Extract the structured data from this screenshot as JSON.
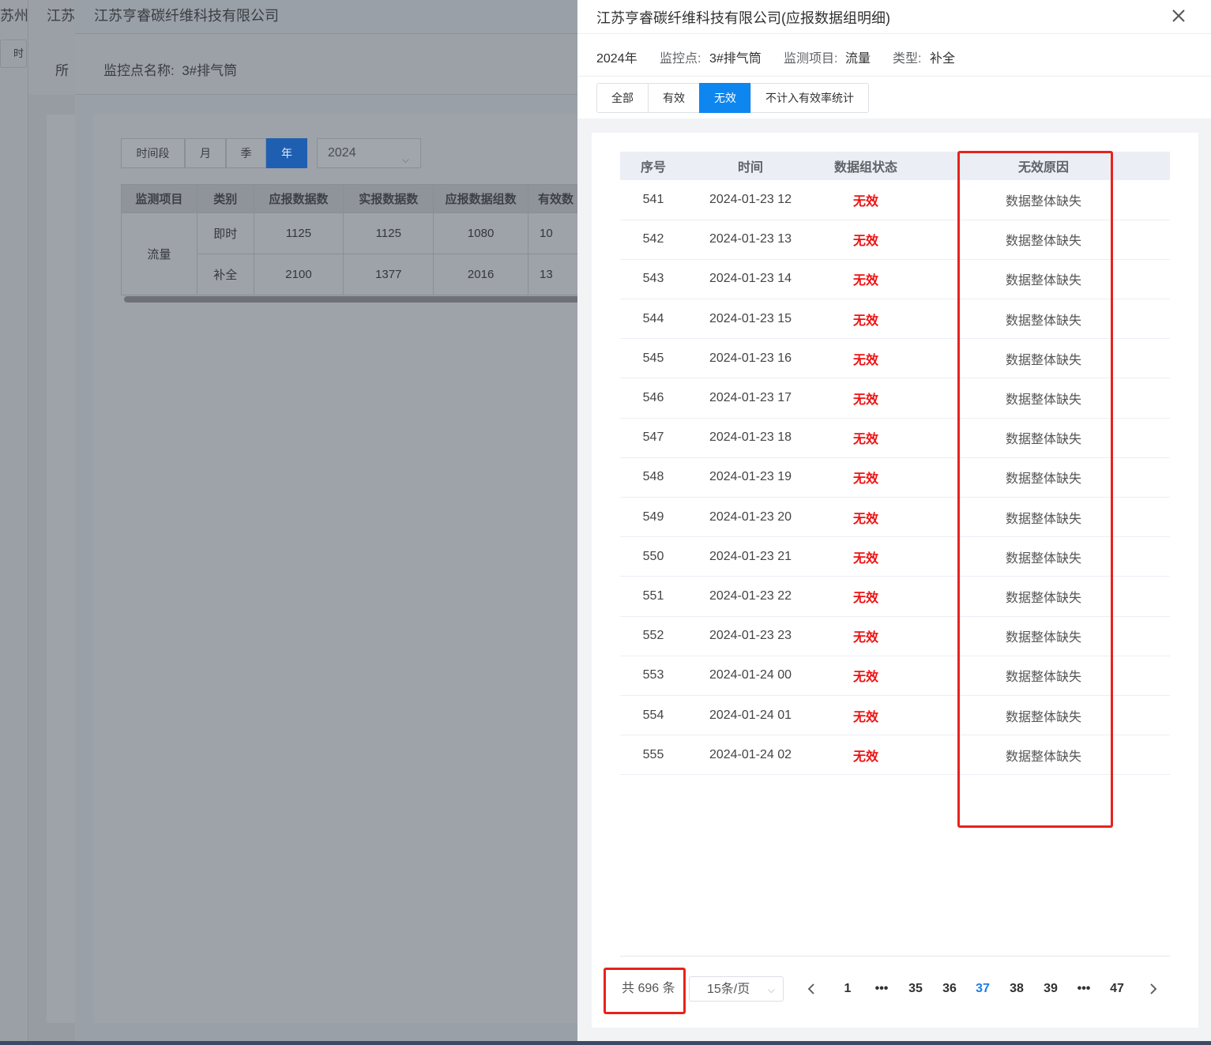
{
  "background": {
    "crumbs": [
      "苏州",
      "江苏"
    ],
    "strip_button": "时",
    "strip_label": "所",
    "panel_title": "江苏亨睿碳纤维科技有限公司",
    "point_name_label": "监控点名称:",
    "point_name_value": "3#排气筒",
    "period_tabs": [
      "时间段",
      "月",
      "季",
      "年"
    ],
    "active_period": "年",
    "year_select": "2024",
    "table": {
      "headers": [
        "监测项目",
        "类别",
        "应报数据数",
        "实报数据数",
        "应报数据组数",
        "有效数"
      ],
      "item": "流量",
      "rows": [
        {
          "category": "即时",
          "c1": "1125",
          "c2": "1125",
          "c3": "1080",
          "c4": "10"
        },
        {
          "category": "补全",
          "c1": "2100",
          "c2": "1377",
          "c3": "2016",
          "c4": "13"
        }
      ]
    }
  },
  "drawer": {
    "title": "江苏亨睿碳纤维科技有限公司(应报数据组明细)",
    "info": {
      "year": "2024年",
      "point_label": "监控点:",
      "point_value": "3#排气筒",
      "item_label": "监测项目:",
      "item_value": "流量",
      "type_label": "类型:",
      "type_value": "补全"
    },
    "tabs": [
      "全部",
      "有效",
      "无效",
      "不计入有效率统计"
    ],
    "active_tab": "无效",
    "table": {
      "headers": [
        "序号",
        "时间",
        "数据组状态",
        "无效原因"
      ],
      "rows": [
        {
          "seq": "541",
          "time": "2024-01-23 12",
          "status": "无效",
          "reason": "数据整体缺失"
        },
        {
          "seq": "542",
          "time": "2024-01-23 13",
          "status": "无效",
          "reason": "数据整体缺失"
        },
        {
          "seq": "543",
          "time": "2024-01-23 14",
          "status": "无效",
          "reason": "数据整体缺失"
        },
        {
          "seq": "544",
          "time": "2024-01-23 15",
          "status": "无效",
          "reason": "数据整体缺失"
        },
        {
          "seq": "545",
          "time": "2024-01-23 16",
          "status": "无效",
          "reason": "数据整体缺失"
        },
        {
          "seq": "546",
          "time": "2024-01-23 17",
          "status": "无效",
          "reason": "数据整体缺失"
        },
        {
          "seq": "547",
          "time": "2024-01-23 18",
          "status": "无效",
          "reason": "数据整体缺失"
        },
        {
          "seq": "548",
          "time": "2024-01-23 19",
          "status": "无效",
          "reason": "数据整体缺失"
        },
        {
          "seq": "549",
          "time": "2024-01-23 20",
          "status": "无效",
          "reason": "数据整体缺失"
        },
        {
          "seq": "550",
          "time": "2024-01-23 21",
          "status": "无效",
          "reason": "数据整体缺失"
        },
        {
          "seq": "551",
          "time": "2024-01-23 22",
          "status": "无效",
          "reason": "数据整体缺失"
        },
        {
          "seq": "552",
          "time": "2024-01-23 23",
          "status": "无效",
          "reason": "数据整体缺失"
        },
        {
          "seq": "553",
          "time": "2024-01-24 00",
          "status": "无效",
          "reason": "数据整体缺失"
        },
        {
          "seq": "554",
          "time": "2024-01-24 01",
          "status": "无效",
          "reason": "数据整体缺失"
        },
        {
          "seq": "555",
          "time": "2024-01-24 02",
          "status": "无效",
          "reason": "数据整体缺失"
        }
      ]
    },
    "pagination": {
      "total_text": "共 696 条",
      "page_size": "15条/页",
      "pages": [
        "1",
        "•••",
        "35",
        "36",
        "37",
        "38",
        "39",
        "•••",
        "47"
      ],
      "current": "37"
    }
  },
  "colors": {
    "accent": "#0d86f0",
    "invalid": "#ee1111",
    "highlight_box": "#e8221d"
  }
}
